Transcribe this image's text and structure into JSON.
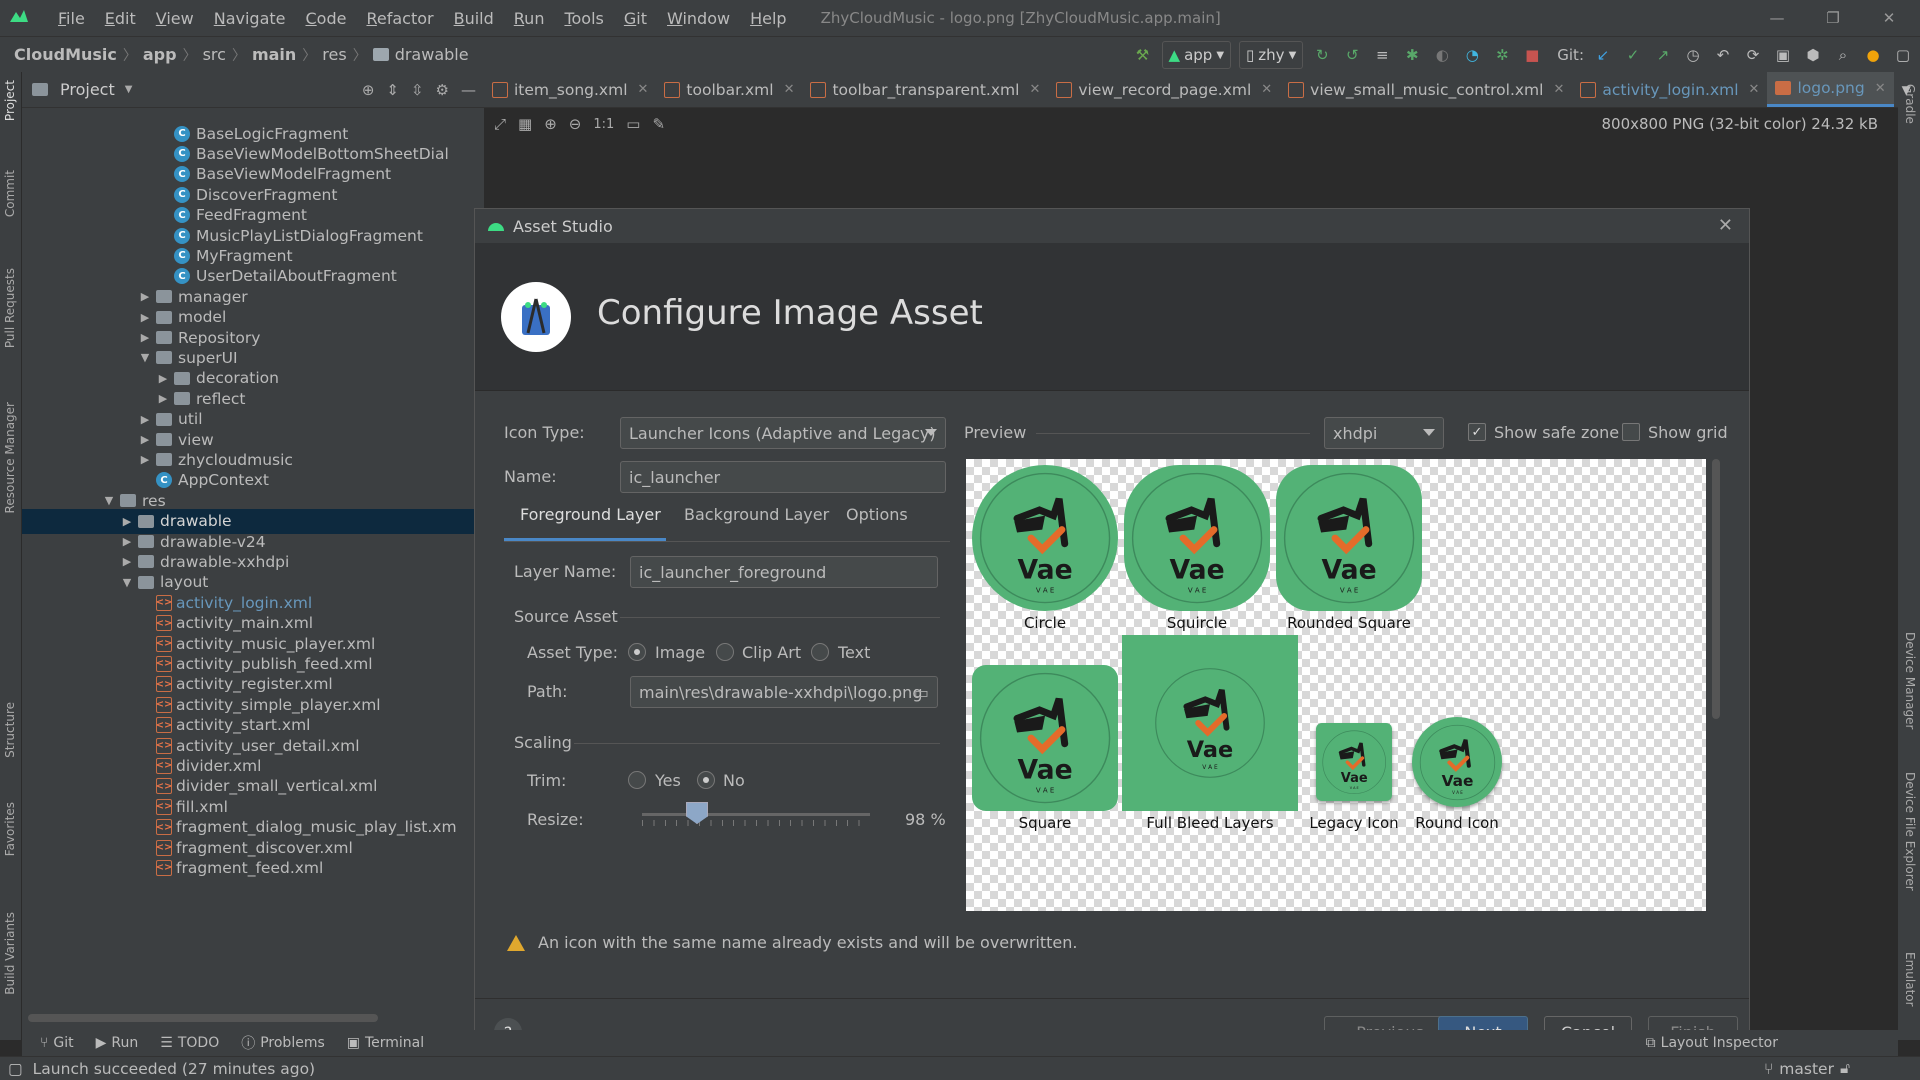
{
  "menubar": {
    "items": [
      "File",
      "Edit",
      "View",
      "Navigate",
      "Code",
      "Refactor",
      "Build",
      "Run",
      "Tools",
      "Git",
      "Window",
      "Help"
    ],
    "window_title": "ZhyCloudMusic - logo.png [ZhyCloudMusic.app.main]"
  },
  "breadcrumb": [
    "CloudMusic",
    "app",
    "src",
    "main",
    "res",
    "drawable"
  ],
  "toolbar": {
    "run_config": "app",
    "device": "zhy",
    "git_label": "Git:"
  },
  "project_panel": {
    "title": "Project",
    "tree": [
      {
        "label": "BaseLogicFragment",
        "type": "class",
        "indent": 3
      },
      {
        "label": "BaseViewModelBottomSheetDial",
        "type": "class",
        "indent": 3
      },
      {
        "label": "BaseViewModelFragment",
        "type": "class",
        "indent": 3
      },
      {
        "label": "DiscoverFragment",
        "type": "class",
        "indent": 3
      },
      {
        "label": "FeedFragment",
        "type": "class",
        "indent": 3
      },
      {
        "label": "MusicPlayListDialogFragment",
        "type": "class",
        "indent": 3
      },
      {
        "label": "MyFragment",
        "type": "class",
        "indent": 3
      },
      {
        "label": "UserDetailAboutFragment",
        "type": "class",
        "indent": 3
      },
      {
        "label": "manager",
        "type": "package",
        "indent": 2,
        "arrow": "right"
      },
      {
        "label": "model",
        "type": "package",
        "indent": 2,
        "arrow": "right"
      },
      {
        "label": "Repository",
        "type": "package",
        "indent": 2,
        "arrow": "right"
      },
      {
        "label": "superUI",
        "type": "package",
        "indent": 2,
        "arrow": "down"
      },
      {
        "label": "decoration",
        "type": "package",
        "indent": 3,
        "arrow": "right"
      },
      {
        "label": "reflect",
        "type": "package",
        "indent": 3,
        "arrow": "right"
      },
      {
        "label": "util",
        "type": "package",
        "indent": 2,
        "arrow": "right"
      },
      {
        "label": "view",
        "type": "package",
        "indent": 2,
        "arrow": "right"
      },
      {
        "label": "zhycloudmusic",
        "type": "package",
        "indent": 2,
        "arrow": "right"
      },
      {
        "label": "AppContext",
        "type": "class",
        "indent": 2
      },
      {
        "label": "res",
        "type": "folder",
        "indent": 0,
        "arrow": "down"
      },
      {
        "label": "drawable",
        "type": "folder",
        "indent": 1,
        "arrow": "right",
        "selected": true
      },
      {
        "label": "drawable-v24",
        "type": "folder",
        "indent": 1,
        "arrow": "right"
      },
      {
        "label": "drawable-xxhdpi",
        "type": "folder",
        "indent": 1,
        "arrow": "right"
      },
      {
        "label": "layout",
        "type": "folder",
        "indent": 1,
        "arrow": "down"
      },
      {
        "label": "activity_login.xml",
        "type": "xml",
        "indent": 2,
        "link": true
      },
      {
        "label": "activity_main.xml",
        "type": "xml",
        "indent": 2
      },
      {
        "label": "activity_music_player.xml",
        "type": "xml",
        "indent": 2
      },
      {
        "label": "activity_publish_feed.xml",
        "type": "xml",
        "indent": 2
      },
      {
        "label": "activity_register.xml",
        "type": "xml",
        "indent": 2
      },
      {
        "label": "activity_simple_player.xml",
        "type": "xml",
        "indent": 2
      },
      {
        "label": "activity_start.xml",
        "type": "xml",
        "indent": 2
      },
      {
        "label": "activity_user_detail.xml",
        "type": "xml",
        "indent": 2
      },
      {
        "label": "divider.xml",
        "type": "xml",
        "indent": 2
      },
      {
        "label": "divider_small_vertical.xml",
        "type": "xml",
        "indent": 2
      },
      {
        "label": "fill.xml",
        "type": "xml",
        "indent": 2
      },
      {
        "label": "fragment_dialog_music_play_list.xm",
        "type": "xml",
        "indent": 2
      },
      {
        "label": "fragment_discover.xml",
        "type": "xml",
        "indent": 2
      },
      {
        "label": "fragment_feed.xml",
        "type": "xml",
        "indent": 2
      }
    ]
  },
  "left_tabs": [
    "Project",
    "Commit",
    "Pull Requests",
    "Resource Manager",
    "Structure",
    "Favorites",
    "Build Variants"
  ],
  "right_tabs": [
    "Gradle",
    "Device Manager",
    "Device File Explorer",
    "Emulator"
  ],
  "editor_tabs": [
    {
      "label": "item_song.xml"
    },
    {
      "label": "toolbar.xml"
    },
    {
      "label": "toolbar_transparent.xml"
    },
    {
      "label": "view_record_page.xml"
    },
    {
      "label": "view_small_music_control.xml"
    },
    {
      "label": "activity_login.xml",
      "link": true
    },
    {
      "label": "logo.png",
      "active": true
    }
  ],
  "editor": {
    "zoom_label": "1:1",
    "image_info": "800x800 PNG (32-bit color) 24.32 kB"
  },
  "dialog": {
    "window_title": "Asset Studio",
    "header_title": "Configure Image Asset",
    "icon_type_label": "Icon Type:",
    "icon_type_value": "Launcher Icons (Adaptive and Legacy)",
    "name_label": "Name:",
    "name_value": "ic_launcher",
    "tabs": [
      "Foreground Layer",
      "Background Layer",
      "Options"
    ],
    "layer_name_label": "Layer Name:",
    "layer_name_value": "ic_launcher_foreground",
    "source_asset_label": "Source Asset",
    "asset_type_label": "Asset Type:",
    "asset_types": [
      "Image",
      "Clip Art",
      "Text"
    ],
    "path_label": "Path:",
    "path_value": "main\\res\\drawable-xxhdpi\\logo.png",
    "scaling_label": "Scaling",
    "trim_label": "Trim:",
    "trim_options": [
      "Yes",
      "No"
    ],
    "resize_label": "Resize:",
    "resize_value": "98 %",
    "resize_fraction": 0.98,
    "preview_label": "Preview",
    "density_value": "xhdpi",
    "show_safe_zone_label": "Show safe zone",
    "show_safe_zone": true,
    "show_grid_label": "Show grid",
    "show_grid": false,
    "preview_items": [
      "Circle",
      "Squircle",
      "Rounded Square",
      "Square",
      "Full Bleed Layers",
      "Legacy Icon",
      "Round Icon"
    ],
    "logo_text": "Vae",
    "logo_subtext": "V A E",
    "warning": "An icon with the same name already exists and will be overwritten.",
    "buttons": {
      "previous": "Previous",
      "next": "Next",
      "cancel": "Cancel",
      "finish": "Finish"
    },
    "help": "?"
  },
  "tool_windows": [
    "Git",
    "Run",
    "TODO",
    "Problems",
    "Terminal",
    "Layout Inspector"
  ],
  "status": {
    "message": "Launch succeeded (27 minutes ago)",
    "branch": "master"
  },
  "colors": {
    "icon_green": "#53b276",
    "accent": "#4a88c7",
    "warn": "#e0a82e",
    "logo_orange": "#e46b2a"
  }
}
